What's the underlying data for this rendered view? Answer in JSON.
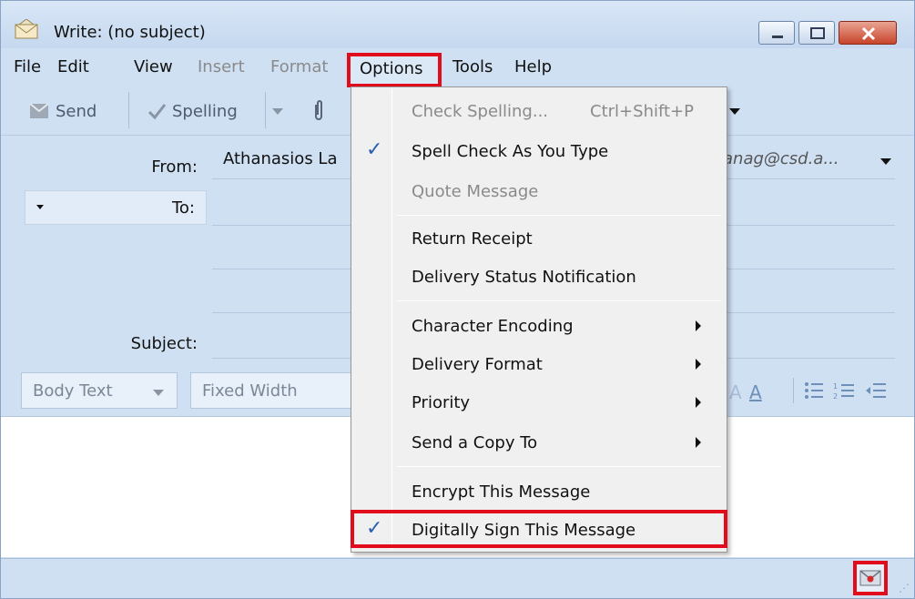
{
  "window": {
    "title": "Write: (no subject)"
  },
  "menubar": {
    "file": "File",
    "edit": "Edit",
    "view": "View",
    "insert": "Insert",
    "format": "Format",
    "options": "Options",
    "tools": "Tools",
    "help": "Help"
  },
  "toolbar": {
    "send": "Send",
    "spelling": "Spelling"
  },
  "header": {
    "from_label": "From:",
    "from_name": "Athanasios La",
    "from_email": "anag@csd.a...",
    "to_label": "To:",
    "subject_label": "Subject:"
  },
  "formatbar": {
    "paragraph_style": "Body Text",
    "font": "Fixed Width"
  },
  "options_menu": {
    "items": [
      {
        "label": "Check Spelling...",
        "shortcut": "Ctrl+Shift+P",
        "disabled": true
      },
      {
        "label": "Spell Check As You Type",
        "checked": true
      },
      {
        "label": "Quote Message",
        "disabled": true
      },
      {
        "label": "Return Receipt"
      },
      {
        "label": "Delivery Status Notification"
      },
      {
        "label": "Character Encoding",
        "submenu": true
      },
      {
        "label": "Delivery Format",
        "submenu": true
      },
      {
        "label": "Priority",
        "submenu": true
      },
      {
        "label": "Send a Copy To",
        "submenu": true
      },
      {
        "label": "Encrypt This Message"
      },
      {
        "label": "Digitally Sign This Message",
        "checked": true
      }
    ]
  },
  "colors": {
    "highlight_border": "#e10d1d",
    "window_chrome": "#cfe0f3",
    "check_mark": "#2a5fb0"
  },
  "icons": {
    "title": "compose-envelope-icon",
    "status": "signed-envelope-icon"
  }
}
